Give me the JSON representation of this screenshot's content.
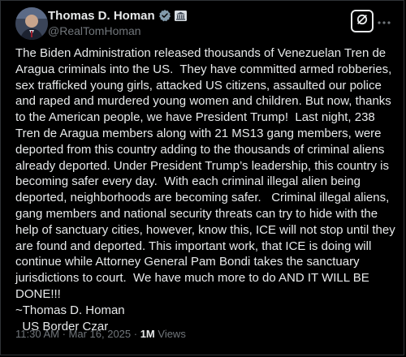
{
  "post": {
    "author_name": "Thomas D. Homan",
    "handle": "@RealTomHoman",
    "verified_icon": "verified-badge-icon",
    "affiliation_icon": "government-building-icon",
    "grok_icon": "grok-icon",
    "more_icon": "more-options-icon",
    "text": "The Biden Administration released thousands of Venezuelan Tren de Aragua criminals into the US.  They have committed armed robberies, sex trafficked young girls, attacked US citizens, assaulted our police and raped and murdered young women and children. But now, thanks to the American people, we have President Trump!  Last night, 238 Tren de Aragua members along with 21 MS13 gang members, were deported from this country adding to the thousands of criminal aliens already deported. Under President Trump’s leadership, this country is becoming safer every day.  With each criminal illegal alien being deported, neighborhoods are becoming safer.   Criminal illegal aliens, gang members and national security threats can try to hide with the help of sanctuary cities, however, know this, ICE will not stop until they are found and deported. This important work, that ICE is doing will continue while Attorney General Pam Bondi takes the sanctuary jurisdictions to court.  We have much more to do AND IT WILL BE DONE!!!\n~Thomas D. Homan\n  US Border Czar",
    "time": "11:30 AM",
    "separator": " · ",
    "date": "Mar 16, 2025",
    "views_count": "1M",
    "views_label": " Views"
  },
  "colors": {
    "background": "#000000",
    "text": "#e7e9ea",
    "muted": "#71767b",
    "verified": "#829aab"
  }
}
